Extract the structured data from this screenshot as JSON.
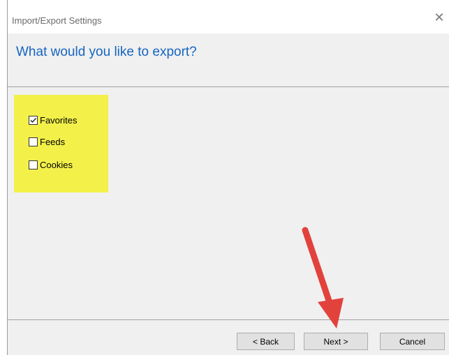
{
  "dialog": {
    "title": "Import/Export Settings",
    "close_glyph": "✕",
    "heading": "What would you like to export?"
  },
  "options": [
    {
      "label": "Favorites",
      "checked": true
    },
    {
      "label": "Feeds",
      "checked": false
    },
    {
      "label": "Cookies",
      "checked": false
    }
  ],
  "buttons": {
    "back": "< Back",
    "next": "Next >",
    "cancel": "Cancel"
  },
  "colors": {
    "heading": "#1665c0",
    "highlight": "#f3f04a",
    "arrow": "#e2423c"
  }
}
